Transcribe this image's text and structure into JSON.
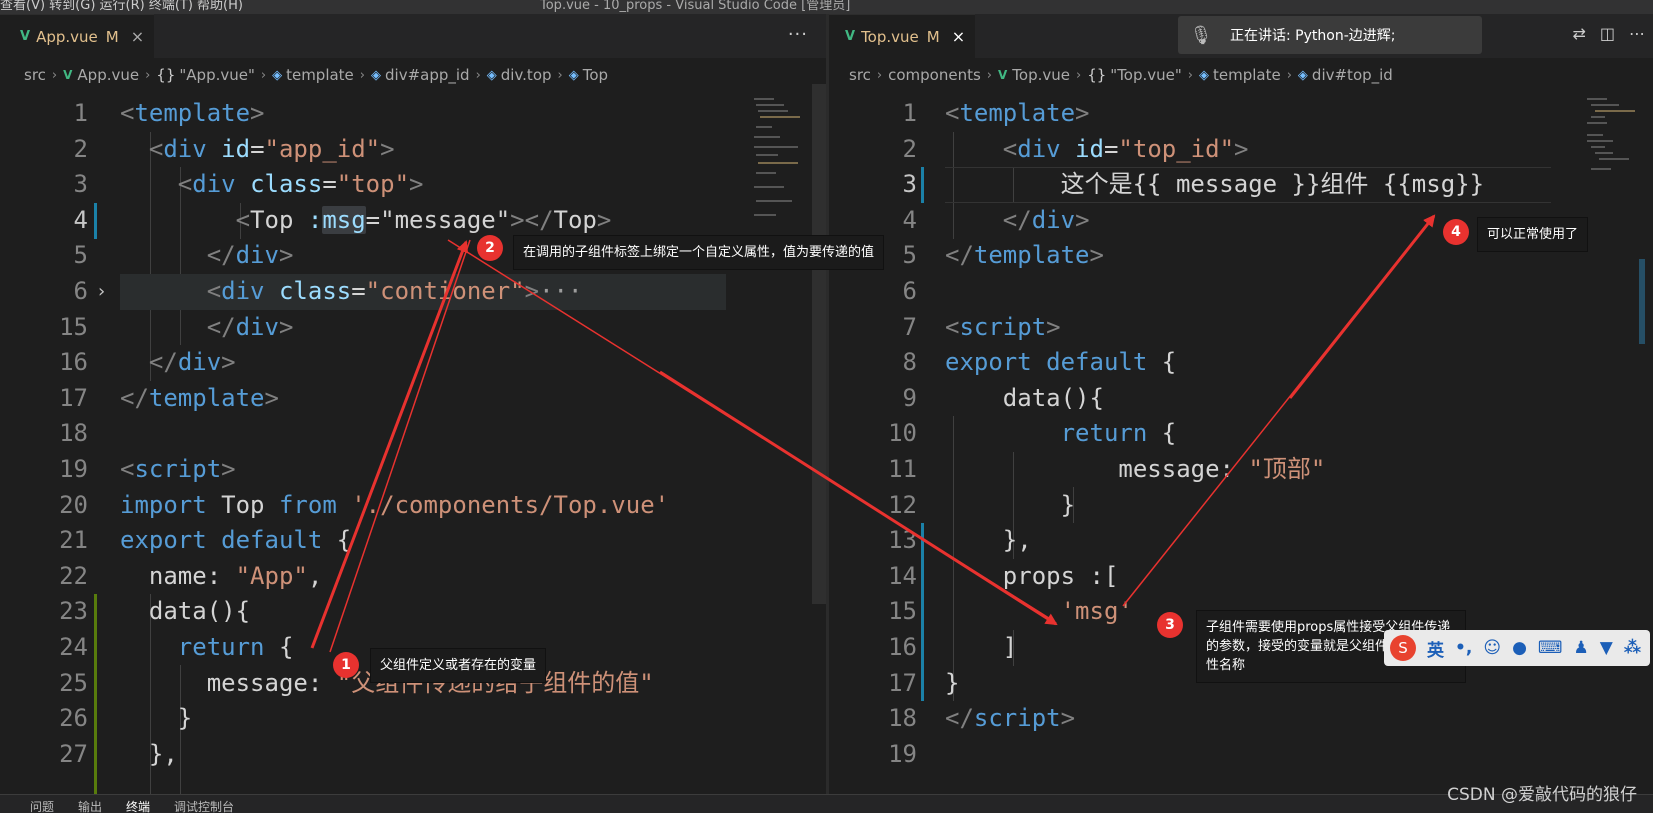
{
  "titlebar": {
    "menu": "查看(V)   转到(G)   运行(R)   终端(T)   帮助(H)",
    "window_title": "Top.vue - 10_props - Visual Studio Code [管理员]"
  },
  "left": {
    "tab": {
      "name": "App.vue",
      "modified": "M",
      "close": "×"
    },
    "tab_more": "···",
    "breadcrumb": [
      "src",
      "App.vue",
      "\"App.vue\"",
      "template",
      "div#app_id",
      "div.top",
      "Top"
    ],
    "line_numbers": [
      "1",
      "2",
      "3",
      "4",
      "5",
      "6",
      "15",
      "16",
      "17",
      "18",
      "19",
      "20",
      "21",
      "22",
      "23",
      "24",
      "25",
      "26",
      "27"
    ],
    "code": {
      "l1_tag": "template",
      "l2_tag": "div",
      "l2_attr": "id",
      "l2_val": "\"app_id\"",
      "l3_tag": "div",
      "l3_attr": "class",
      "l3_val": "\"top\"",
      "l4_comp": "Top",
      "l4_bind_colon": ":",
      "l4_attr": "msg",
      "l4_val": "\"message\"",
      "l4_close": "Top",
      "l5_tag": "div",
      "l6_tag": "div",
      "l6_attr": "class",
      "l6_val": "\"contioner\"",
      "l6_ellipsis": "···",
      "l15_tag": "div",
      "l16_tag": "div",
      "l17_tag": "template",
      "l19_tag": "script",
      "l20_import": "import",
      "l20_name": "Top",
      "l20_from": "from",
      "l20_path": "'./components/Top.vue'",
      "l21_export": "export",
      "l21_default": "default",
      "l21_brace": "{",
      "l22_key": "name:",
      "l22_val": "\"App\"",
      "l22_comma": ",",
      "l23_fn": "data",
      "l23_rest": "(){",
      "l24_return": "return",
      "l24_brace": "{",
      "l25_key": "message:",
      "l25_val": "\"父组件传递的给子组件的值\"",
      "l26_brace": "}",
      "l27_brace": "},"
    }
  },
  "right": {
    "tab": {
      "name": "Top.vue",
      "modified": "M",
      "close": "×"
    },
    "breadcrumb": [
      "src",
      "components",
      "Top.vue",
      "\"Top.vue\"",
      "template",
      "div#top_id"
    ],
    "line_numbers": [
      "1",
      "2",
      "3",
      "4",
      "5",
      "6",
      "7",
      "8",
      "9",
      "10",
      "11",
      "12",
      "13",
      "14",
      "15",
      "16",
      "17",
      "18",
      "19"
    ],
    "code": {
      "l1_tag": "template",
      "l2_tag": "div",
      "l2_attr": "id",
      "l2_val": "\"top_id\"",
      "l3_text1": "这个是",
      "l3_mustache1": "{{ message }}",
      "l3_text2": "组件 ",
      "l3_mustache2": "{{msg}}",
      "l4_tag": "div",
      "l5_tag": "template",
      "l7_tag": "script",
      "l8_export": "export",
      "l8_default": "default",
      "l8_brace": "{",
      "l9_fn": "data",
      "l9_rest": "(){",
      "l10_return": "return",
      "l10_brace": "{",
      "l11_key": "message:",
      "l11_val": "\"顶部\"",
      "l12_brace": "}",
      "l13_brace": "},",
      "l14_key": "props",
      "l14_rest": " :[",
      "l15_val": "'msg'",
      "l16_brace": "]",
      "l17_brace": "}",
      "l18_tag": "script"
    }
  },
  "annotations": [
    {
      "num": "1",
      "text": "父组件定义或者存在的变量"
    },
    {
      "num": "2",
      "text": "在调用的子组件标签上绑定一个自定义属性，值为要传递的值"
    },
    {
      "num": "3",
      "text": "子组件需要使用props属性接受父组件传递的参数，接受的变量就是父组件自定义的属性名称"
    },
    {
      "num": "4",
      "text": "可以正常使用了"
    }
  ],
  "speech_bar": {
    "text": "正在讲话: Python-边进辉;"
  },
  "ime_bar": {
    "logo": "S",
    "lang": "英",
    "punct": "•,"
  },
  "bottom_panel": {
    "tabs": [
      "问题",
      "输出",
      "终端",
      "调试控制台"
    ]
  },
  "watermark": "CSDN @爱敲代码的狼仔",
  "colors": {
    "annotation_red": "#e8322f",
    "vue_green": "#41b883",
    "tag_blue": "#569cd6",
    "string_orange": "#ce9178",
    "attr_lightblue": "#9cdcfe"
  }
}
